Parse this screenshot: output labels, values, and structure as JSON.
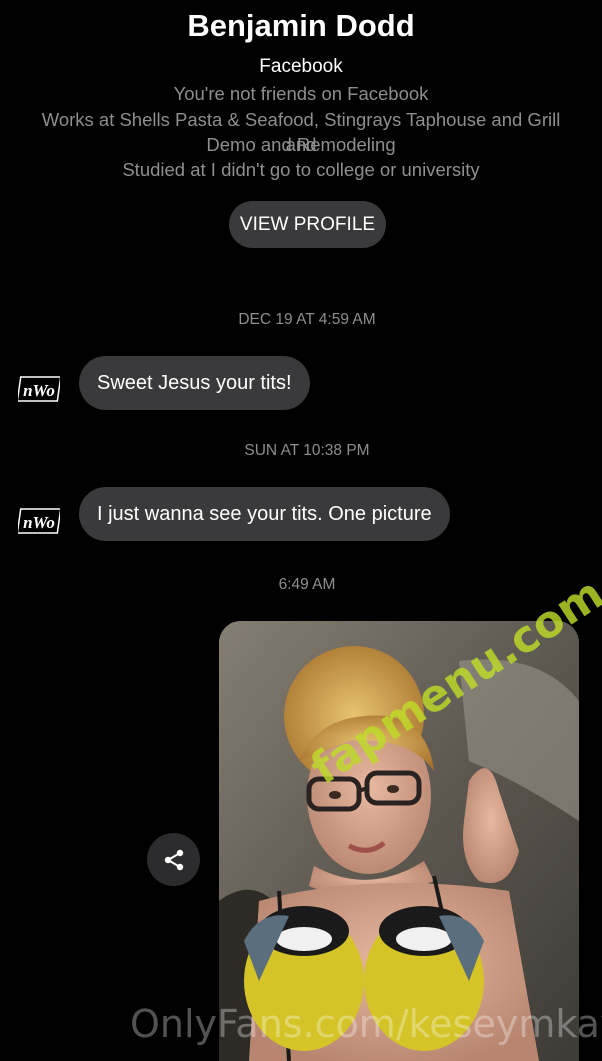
{
  "profile": {
    "name": "Benjamin Dodd",
    "platform": "Facebook",
    "friend_status": "You're not friends on Facebook",
    "work_line1": "Works at Shells Pasta & Seafood, Stingrays Taphouse and Grill and",
    "work_line2": "Demo and Remodeling",
    "education": "Studied at I didn't go to college or university",
    "view_profile_label": "VIEW PROFILE"
  },
  "conversation": [
    {
      "timestamp": "DEC 19 AT 4:59 AM",
      "message": "Sweet Jesus your tits!",
      "avatar_text": "nWo"
    },
    {
      "timestamp": "SUN AT 10:38 PM",
      "message": "I just wanna see your tits. One picture",
      "avatar_text": "nWo"
    },
    {
      "timestamp": "6:49 AM"
    }
  ],
  "icons": {
    "share": "share-icon"
  },
  "watermarks": {
    "diagonal": "fapmenu.com",
    "bottom": "OnlyFans.com/keseymkay"
  },
  "colors": {
    "background": "#000000",
    "bubble": "#3a3a3c",
    "muted_text": "#8e8e8e",
    "watermark_green": "#bedc28"
  }
}
